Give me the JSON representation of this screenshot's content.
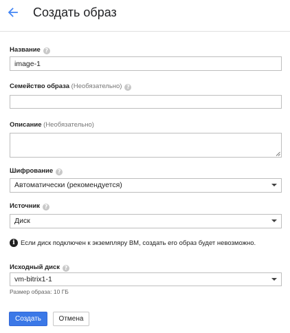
{
  "header": {
    "back_icon": "arrow-back-icon",
    "title": "Создать образ"
  },
  "form": {
    "name": {
      "label": "Название",
      "value": "image-1"
    },
    "family": {
      "label": "Семейство образа",
      "optional": "(Необязательно)",
      "value": ""
    },
    "description": {
      "label": "Описание",
      "optional": "(Необязательно)",
      "value": ""
    },
    "encryption": {
      "label": "Шифрование",
      "value": "Автоматически (рекомендуется)"
    },
    "source": {
      "label": "Источник",
      "value": "Диск"
    },
    "info": "Если диск подключен к экземпляру ВМ, создать его образ будет невозможно.",
    "source_disk": {
      "label": "Исходный диск",
      "value": "vm-bitrix1-1"
    },
    "image_size_note": "Размер образа: 10 ГБ"
  },
  "buttons": {
    "create": "Создать",
    "cancel": "Отмена"
  },
  "colors": {
    "accent": "#3b78e7",
    "back_arrow": "#4285f4"
  }
}
